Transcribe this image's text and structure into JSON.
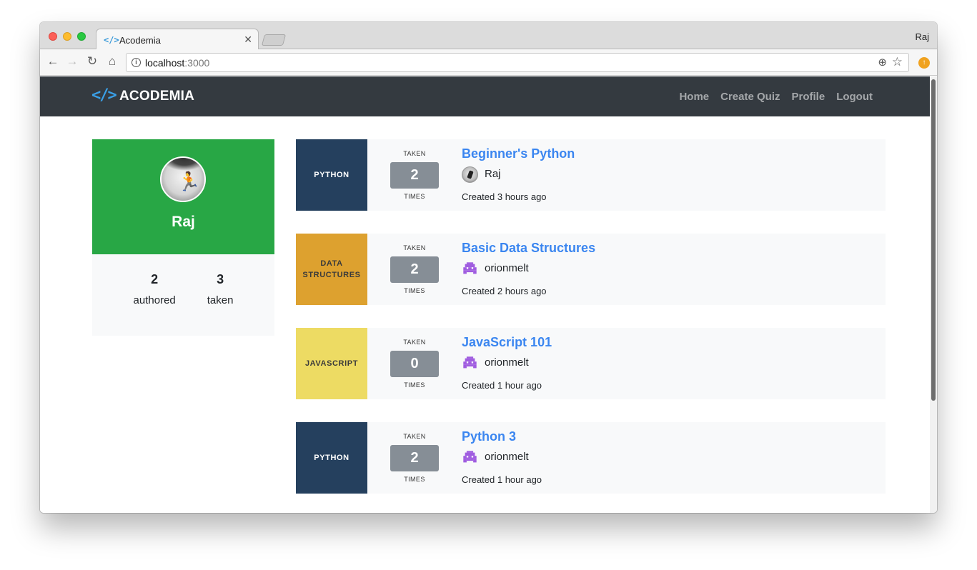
{
  "browser": {
    "tab_title": "Acodemia",
    "tab_icon": "code-icon",
    "profile_name": "Raj",
    "url_host": "localhost",
    "url_port": ":3000"
  },
  "navbar": {
    "brand_icon": "</>",
    "brand": "ACODEMIA",
    "links": [
      "Home",
      "Create Quiz",
      "Profile",
      "Logout"
    ]
  },
  "profile": {
    "name": "Raj",
    "authored_count": "2",
    "authored_label": "authored",
    "taken_count": "3",
    "taken_label": "taken"
  },
  "colors": {
    "python": "#25405e",
    "data_structures": "#dda12f",
    "javascript": "#eddb63",
    "profile_green": "#28a745",
    "navbar": "#343a40",
    "link_blue": "#3b86f0"
  },
  "quizzes": [
    {
      "category": "PYTHON",
      "taken_label": "TAKEN",
      "count": "2",
      "times_label": "TIMES",
      "title": "Beginner's Python",
      "author": "Raj",
      "created": "Created 3 hours ago"
    },
    {
      "category": "DATA STRUCTURES",
      "taken_label": "TAKEN",
      "count": "2",
      "times_label": "TIMES",
      "title": "Basic Data Structures",
      "author": "orionmelt",
      "created": "Created 2 hours ago"
    },
    {
      "category": "JAVASCRIPT",
      "taken_label": "TAKEN",
      "count": "0",
      "times_label": "TIMES",
      "title": "JavaScript 101",
      "author": "orionmelt",
      "created": "Created 1 hour ago"
    },
    {
      "category": "PYTHON",
      "taken_label": "TAKEN",
      "count": "2",
      "times_label": "TIMES",
      "title": "Python 3",
      "author": "orionmelt",
      "created": "Created 1 hour ago"
    }
  ]
}
